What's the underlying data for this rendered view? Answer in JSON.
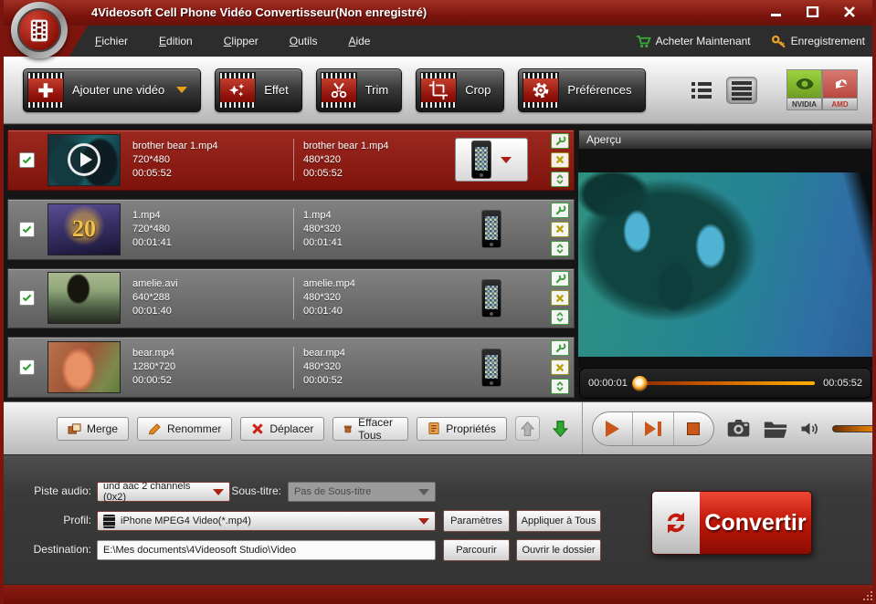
{
  "window": {
    "title": "4Videosoft Cell Phone Vidéo Convertisseur(Non enregistré)"
  },
  "menu": {
    "items": [
      "Fichier",
      "Edition",
      "Clipper",
      "Outils",
      "Aide"
    ],
    "buy_label": "Acheter Maintenant",
    "register_label": "Enregistrement"
  },
  "toolbar": {
    "add_video": "Ajouter une vidéo",
    "effect": "Effet",
    "trim": "Trim",
    "crop": "Crop",
    "preferences": "Préférences",
    "gpu": {
      "nvidia": "NVIDIA",
      "amd": "AMD"
    }
  },
  "file_list": {
    "rows": [
      {
        "source_name": "brother bear 1.mp4",
        "source_res": "720*480",
        "source_dur": "00:05:52",
        "out_name": "brother bear 1.mp4",
        "out_res": "480*320",
        "out_dur": "00:05:52"
      },
      {
        "source_name": "1.mp4",
        "source_res": "720*480",
        "source_dur": "00:01:41",
        "out_name": "1.mp4",
        "out_res": "480*320",
        "out_dur": "00:01:41",
        "thumb_label": "20"
      },
      {
        "source_name": "amelie.avi",
        "source_res": "640*288",
        "source_dur": "00:01:40",
        "out_name": "amelie.mp4",
        "out_res": "480*320",
        "out_dur": "00:01:40"
      },
      {
        "source_name": "bear.mp4",
        "source_res": "1280*720",
        "source_dur": "00:00:52",
        "out_name": "bear.mp4",
        "out_res": "480*320",
        "out_dur": "00:00:52"
      }
    ]
  },
  "preview": {
    "title": "Aperçu",
    "current_time": "00:00:01",
    "total_time": "00:05:52"
  },
  "actions": {
    "merge": "Merge",
    "rename": "Renommer",
    "move": "Déplacer",
    "clear_all": "Effacer Tous",
    "properties": "Propriétés"
  },
  "settings": {
    "audio_label": "Piste audio:",
    "audio_value": "und aac 2 channels (0x2)",
    "subtitle_label": "Sous-titre:",
    "subtitle_value": "Pas de Sous-titre",
    "profile_label": "Profil:",
    "profile_value": "iPhone MPEG4 Video(*.mp4)",
    "settings_btn": "Paramètres",
    "apply_all_btn": "Appliquer à Tous",
    "dest_label": "Destination:",
    "dest_value": "E:\\Mes documents\\4Videosoft Studio\\Video",
    "browse_btn": "Parcourir",
    "open_folder_btn": "Ouvrir le dossier",
    "convert_btn": "Convertir"
  },
  "colors": {
    "brand_red": "#7c150e",
    "accent_orange": "#ffa500",
    "convert_red": "#c01708",
    "row_selected": "#8e1e14"
  }
}
